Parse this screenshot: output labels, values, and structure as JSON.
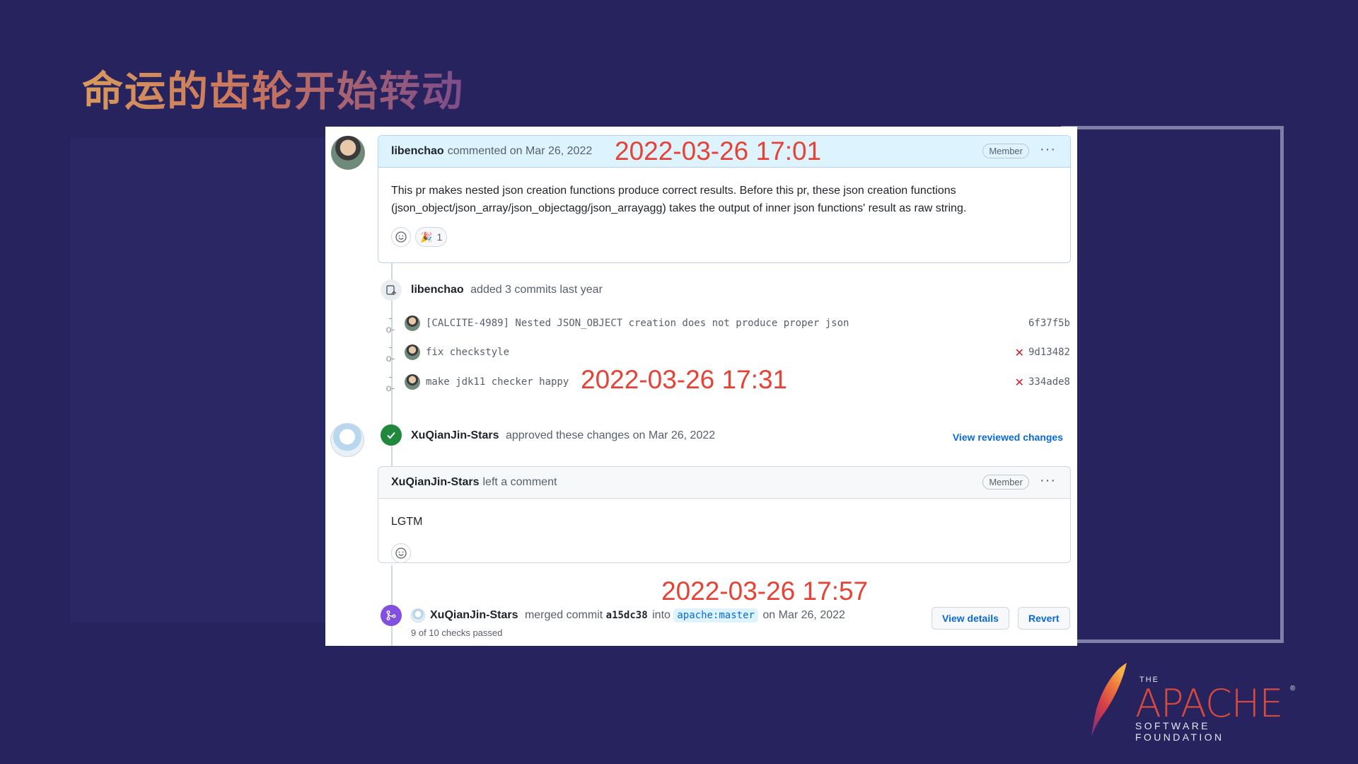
{
  "slide": {
    "title": "命运的齿轮开始转动"
  },
  "annotations": {
    "first": "2022-03-26 17:01",
    "second": "2022-03-26 17:31",
    "third": "2022-03-26 17:57"
  },
  "comment1": {
    "author": "libenchao",
    "meta": "commented on Mar 26, 2022",
    "badge": "Member",
    "more": "···",
    "body": "This pr makes nested json creation functions produce correct results. Before this pr, these json creation functions (json_object/json_array/json_objectagg/json_arrayagg) takes the output of inner json functions' result as raw string.",
    "reaction_emoji": "🎉",
    "reaction_count": "1"
  },
  "commits_event": {
    "author": "libenchao",
    "text": "added 3 commits last year",
    "commits": [
      {
        "message": "[CALCITE-4989] Nested JSON_OBJECT creation does not produce proper json",
        "sha": "6f37f5b",
        "status": "none"
      },
      {
        "message": "fix checkstyle",
        "sha": "9d13482",
        "status": "failed"
      },
      {
        "message": "make jdk11 checker happy",
        "sha": "334ade8",
        "status": "failed"
      }
    ]
  },
  "review_event": {
    "author": "XuQianJin-Stars",
    "text": "approved these changes on Mar 26, 2022",
    "link": "View reviewed changes"
  },
  "comment2": {
    "author": "XuQianJin-Stars",
    "meta": "left a comment",
    "badge": "Member",
    "more": "···",
    "body": "LGTM"
  },
  "merge_event": {
    "author": "XuQianJin-Stars",
    "text1": "merged commit",
    "sha": "a15dc38",
    "text2": "into",
    "branch": "apache:master",
    "text3": "on Mar 26, 2022",
    "checks": "9 of 10 checks passed",
    "view_details": "View details",
    "revert": "Revert"
  },
  "logo": {
    "the": "THE",
    "name": "APACHE",
    "reg": "®",
    "sub": "SOFTWARE FOUNDATION"
  },
  "colors": {
    "background": "#27235f",
    "annotation": "#e74235",
    "github_link": "#0969da",
    "approved_green": "#1f883d",
    "merged_purple": "#8250df"
  }
}
